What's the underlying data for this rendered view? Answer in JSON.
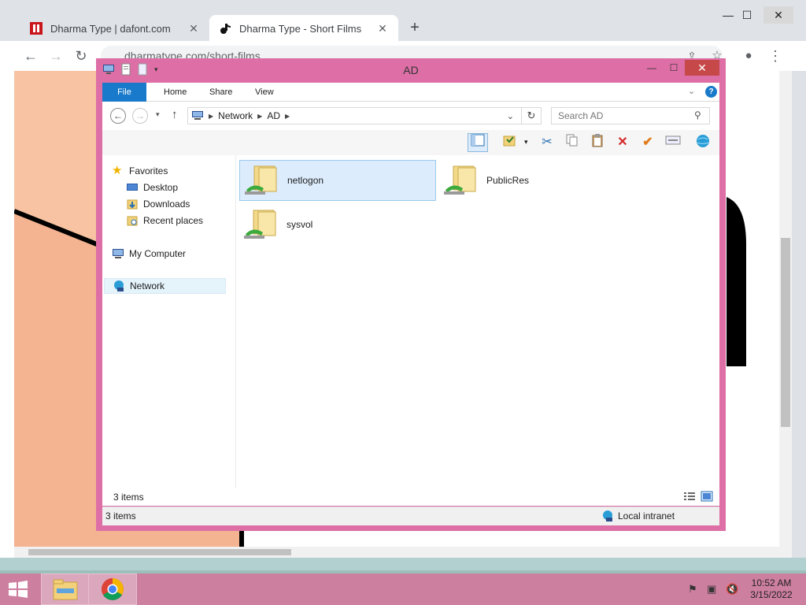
{
  "browser": {
    "tabs": [
      {
        "title": "Dharma Type | dafont.com",
        "active": false
      },
      {
        "title": "Dharma Type - Short Films",
        "active": true
      }
    ],
    "url": "dharmatype.com/short-films"
  },
  "explorer": {
    "title": "AD",
    "ribbon_tabs": [
      "File",
      "Home",
      "Share",
      "View"
    ],
    "breadcrumb": [
      "Network",
      "AD"
    ],
    "search_placeholder": "Search AD",
    "nav": {
      "favorites": "Favorites",
      "desktop": "Desktop",
      "downloads": "Downloads",
      "recent": "Recent places",
      "computer": "My Computer",
      "network": "Network"
    },
    "items": [
      {
        "name": "netlogon",
        "selected": true
      },
      {
        "name": "PublicRes",
        "selected": false
      },
      {
        "name": "sysvol",
        "selected": false
      }
    ],
    "status_count": "3 items",
    "footer_count": "3 items",
    "zone": "Local intranet"
  },
  "taskbar": {
    "time": "10:52 AM",
    "date": "3/15/2022"
  },
  "colors": {
    "window_frame": "#dd6fa6",
    "taskbar": "#cd7f9f",
    "file_tab": "#1979ca",
    "selection": "#dcecfc"
  }
}
